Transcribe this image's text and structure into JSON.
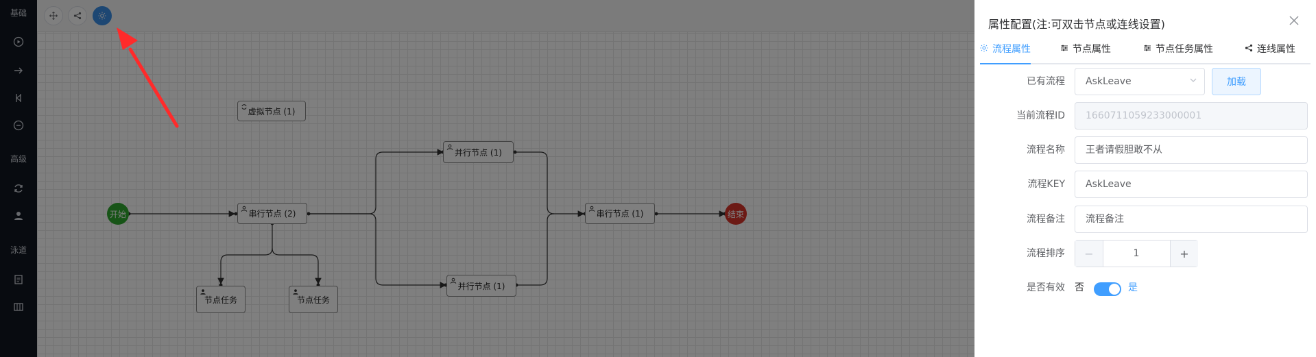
{
  "sidebar": {
    "sections": [
      "基础",
      "高级",
      "泳道"
    ],
    "icons": [
      "play-circle-icon",
      "arrow-right-icon",
      "branch-icon",
      "minus-circle-icon",
      "refresh-icon",
      "user-icon",
      "document-icon",
      "table-icon"
    ]
  },
  "toolbar": {
    "buttons": [
      "move-icon",
      "share-icon",
      "settings-icon"
    ]
  },
  "diagram": {
    "start_label": "开始",
    "end_label": "结束",
    "virtual_node": "虚拟节点 (1)",
    "serial_node_1": "串行节点 (2)",
    "serial_node_2": "串行节点 (1)",
    "parallel_node_top": "并行节点 (1)",
    "parallel_node_bottom": "并行节点 (1)",
    "task_node_1": "节点任务",
    "task_node_2": "节点任务",
    "start_color": "#2ea82e",
    "end_color": "#d9342b"
  },
  "panel": {
    "title": "属性配置(注:可双击节点或连线设置)",
    "tabs": [
      {
        "label": "流程属性",
        "icon": "sun-icon",
        "active": true
      },
      {
        "label": "节点属性",
        "icon": "sliders-icon",
        "active": false
      },
      {
        "label": "节点任务属性",
        "icon": "sliders-icon",
        "active": false
      },
      {
        "label": "连线属性",
        "icon": "share-icon",
        "active": false
      }
    ],
    "form": {
      "existing_flow_label": "已有流程",
      "existing_flow_value": "AskLeave",
      "load_button": "加载",
      "flow_id_label": "当前流程ID",
      "flow_id_value": "1660711059233000001",
      "flow_name_label": "流程名称",
      "flow_name_value": "王者请假胆敢不从",
      "flow_key_label": "流程KEY",
      "flow_key_value": "AskLeave",
      "flow_remark_label": "流程备注",
      "flow_remark_placeholder": "流程备注",
      "flow_sort_label": "流程排序",
      "flow_sort_value": "1",
      "active_label": "是否有效",
      "active_off": "否",
      "active_on": "是",
      "active_value": true
    }
  },
  "colors": {
    "accent": "#409eff",
    "sidebar_bg": "#101620",
    "annotation_arrow": "#ff2a2a"
  }
}
